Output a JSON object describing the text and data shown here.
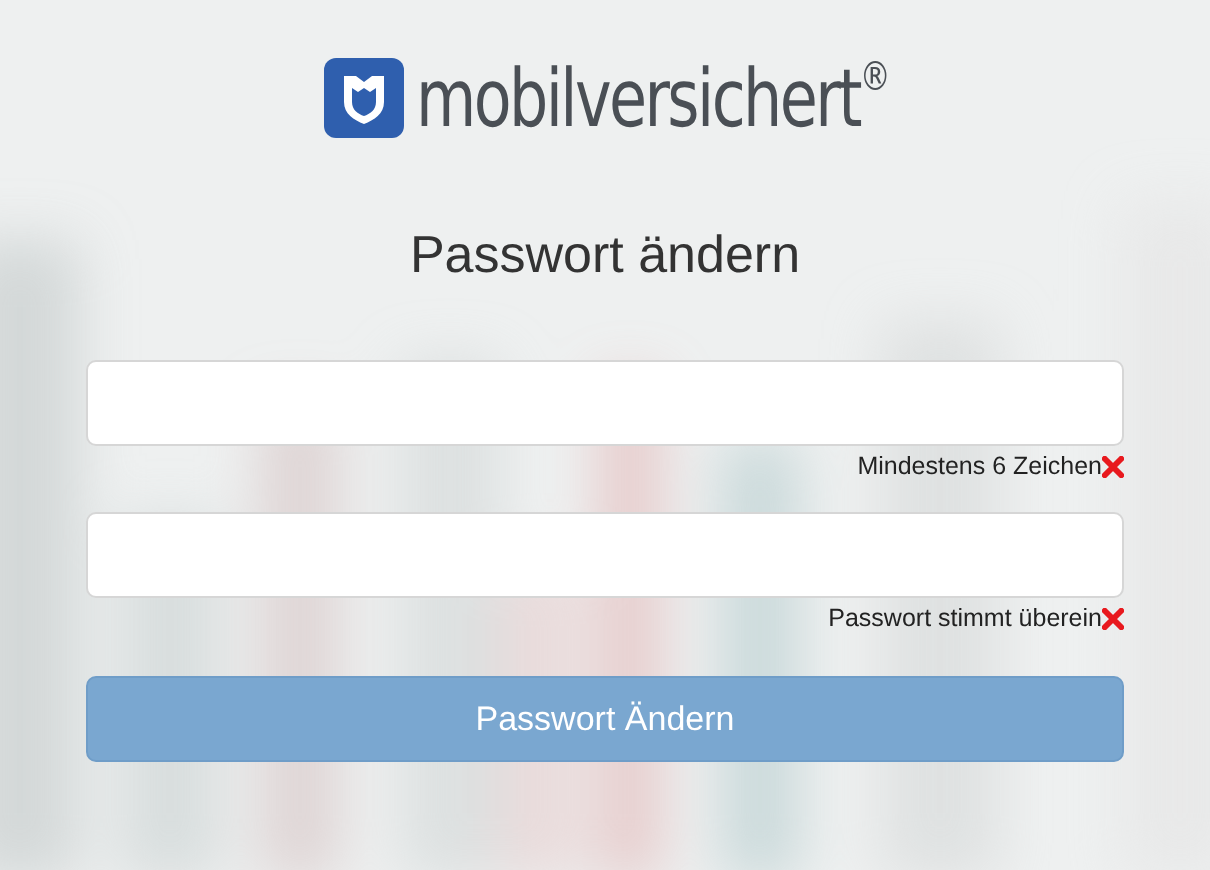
{
  "logo": {
    "text": "mobilversichert$^{®}$"
  },
  "title": "Passwort ändern",
  "fields": [
    {
      "hint": "Mindestens 6 Zeichen",
      "valid": false
    },
    {
      "hint": "Passwort stimmt überein",
      "valid": false
    }
  ],
  "submit": {
    "label": "Passwort Ändern",
    "disabled": true
  }
}
